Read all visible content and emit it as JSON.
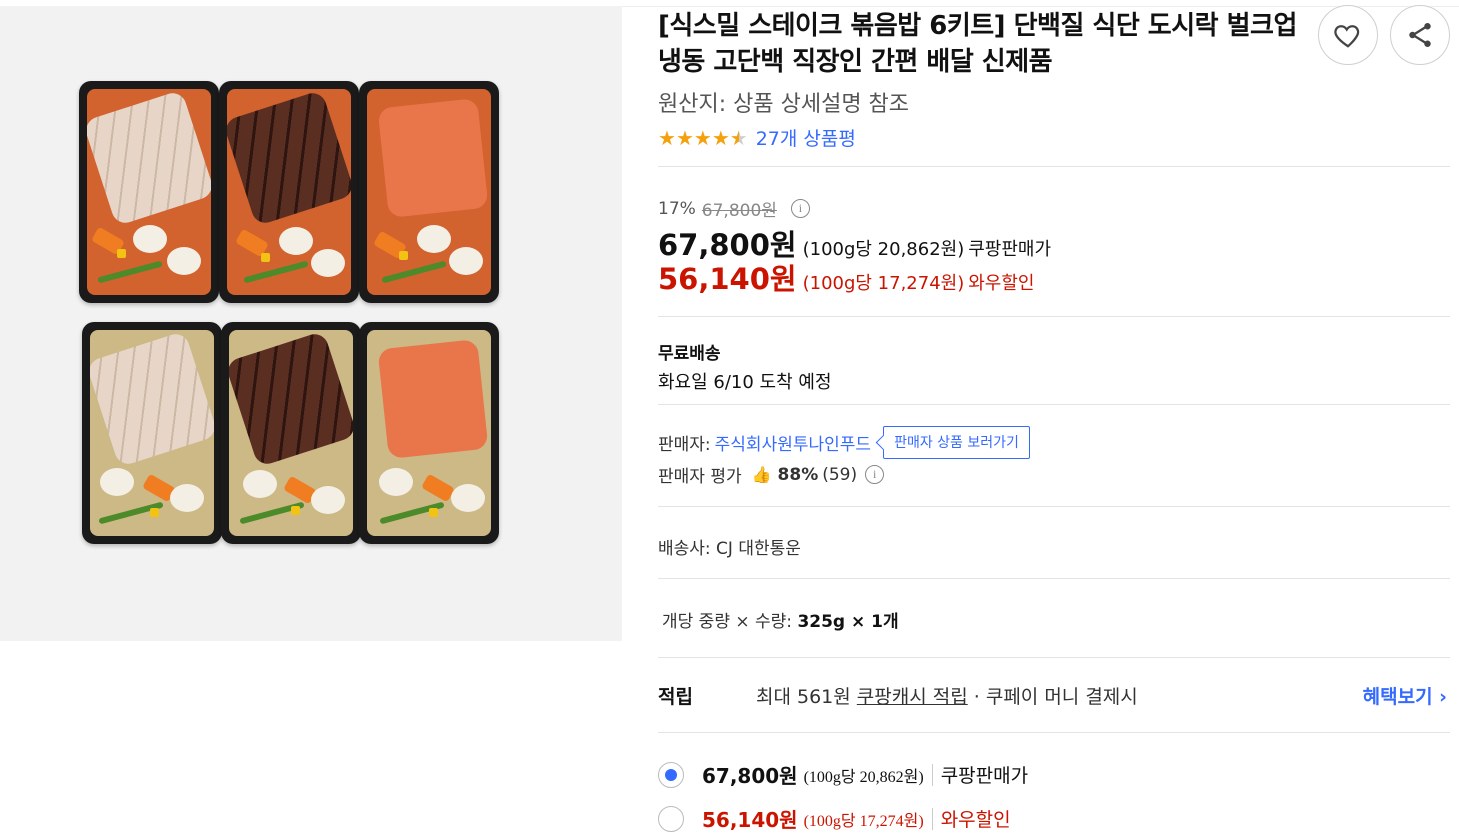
{
  "product": {
    "title": "[식스밀 스테이크 볶음밥 6키트] 단백질 식단 도시락 벌크업 냉동 고단백 직장인 간편 배달 신제품",
    "origin": "원산지: 상품 상세설명 참조",
    "rating": 4.5,
    "review_count": "27개 상품평"
  },
  "pricing": {
    "discount_rate": "17%",
    "original_price": "67,800원",
    "sale_price": "67,800원",
    "sale_unit": "(100g당 20,862원)",
    "sale_label": "쿠팡판매가",
    "wow_price": "56,140원",
    "wow_unit": "(100g당 17,274원)",
    "wow_label": "와우할인"
  },
  "shipping": {
    "title": "무료배송",
    "arrival": "화요일 6/10 도착 예정"
  },
  "seller": {
    "label": "판매자:",
    "name": "주식회사원투나인푸드",
    "button": "판매자 상품 보러가기",
    "rating_label": "판매자 평가",
    "rating_pct": "88%",
    "rating_count": "(59)"
  },
  "carrier": "배송사: CJ 대한통운",
  "weight": {
    "label": "개당 중량 × 수량: ",
    "value": "325g × 1개"
  },
  "reward": {
    "label": "적립",
    "prefix": "최대 561원 ",
    "link": "쿠팡캐시 적립",
    "suffix": " · 쿠페이 머니 결제시",
    "benefit_link": "혜택보기 ›"
  },
  "options": [
    {
      "price": "67,800원",
      "unit": "(100g당 20,862원)",
      "label": "쿠팡판매가",
      "selected": true
    },
    {
      "price": "56,140원",
      "unit": "(100g당 17,274원)",
      "label": "와우할인",
      "selected": false
    }
  ],
  "icons": {
    "heart": "heart-icon",
    "share": "share-icon",
    "info": "info-icon",
    "thumb": "thumbs-up-icon"
  },
  "colors": {
    "accent_blue": "#346aff",
    "sale_red": "#cb1400",
    "star": "#f5a10d"
  }
}
